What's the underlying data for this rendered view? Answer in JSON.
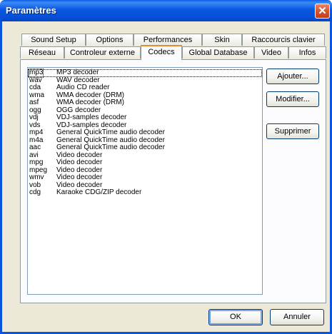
{
  "window": {
    "title": "Paramètres",
    "close_glyph": "✕"
  },
  "tabs": {
    "back_row": [
      "Sound Setup",
      "Options",
      "Performances",
      "Skin",
      "Raccourcis clavier"
    ],
    "front_row": [
      "Réseau",
      "Controleur externe",
      "Codecs",
      "Global Database",
      "Video",
      "Infos"
    ],
    "active": "Codecs"
  },
  "codecs": [
    {
      "ext": "mp3",
      "desc": "MP3 decoder"
    },
    {
      "ext": "wav",
      "desc": "WAV decoder"
    },
    {
      "ext": "cda",
      "desc": "Audio CD reader"
    },
    {
      "ext": "wma",
      "desc": "WMA decoder (DRM)"
    },
    {
      "ext": "asf",
      "desc": "WMA decoder (DRM)"
    },
    {
      "ext": "ogg",
      "desc": "OGG decoder"
    },
    {
      "ext": "vdj",
      "desc": "VDJ-samples decoder"
    },
    {
      "ext": "vds",
      "desc": "VDJ-samples decoder"
    },
    {
      "ext": "mp4",
      "desc": "General QuickTime audio decoder"
    },
    {
      "ext": "m4a",
      "desc": "General QuickTime audio decoder"
    },
    {
      "ext": "aac",
      "desc": "General QuickTime audio decoder"
    },
    {
      "ext": "avi",
      "desc": "Video decoder"
    },
    {
      "ext": "mpg",
      "desc": "Video decoder"
    },
    {
      "ext": "mpeg",
      "desc": "Video decoder"
    },
    {
      "ext": "wmv",
      "desc": "Video decoder"
    },
    {
      "ext": "vob",
      "desc": "Video decoder"
    },
    {
      "ext": "cdg",
      "desc": "Karaoke CDG/ZIP decoder"
    }
  ],
  "buttons": {
    "add": "Ajouter...",
    "modify": "Modifier...",
    "delete": "Supprimer",
    "ok": "OK",
    "cancel": "Annuler"
  },
  "colors": {
    "titlebar": "#0856df",
    "close": "#d8552e",
    "active_tab_accent": "#e68b2c",
    "dialog_bg": "#ece9d8"
  },
  "icons": {
    "close": "close-icon"
  }
}
